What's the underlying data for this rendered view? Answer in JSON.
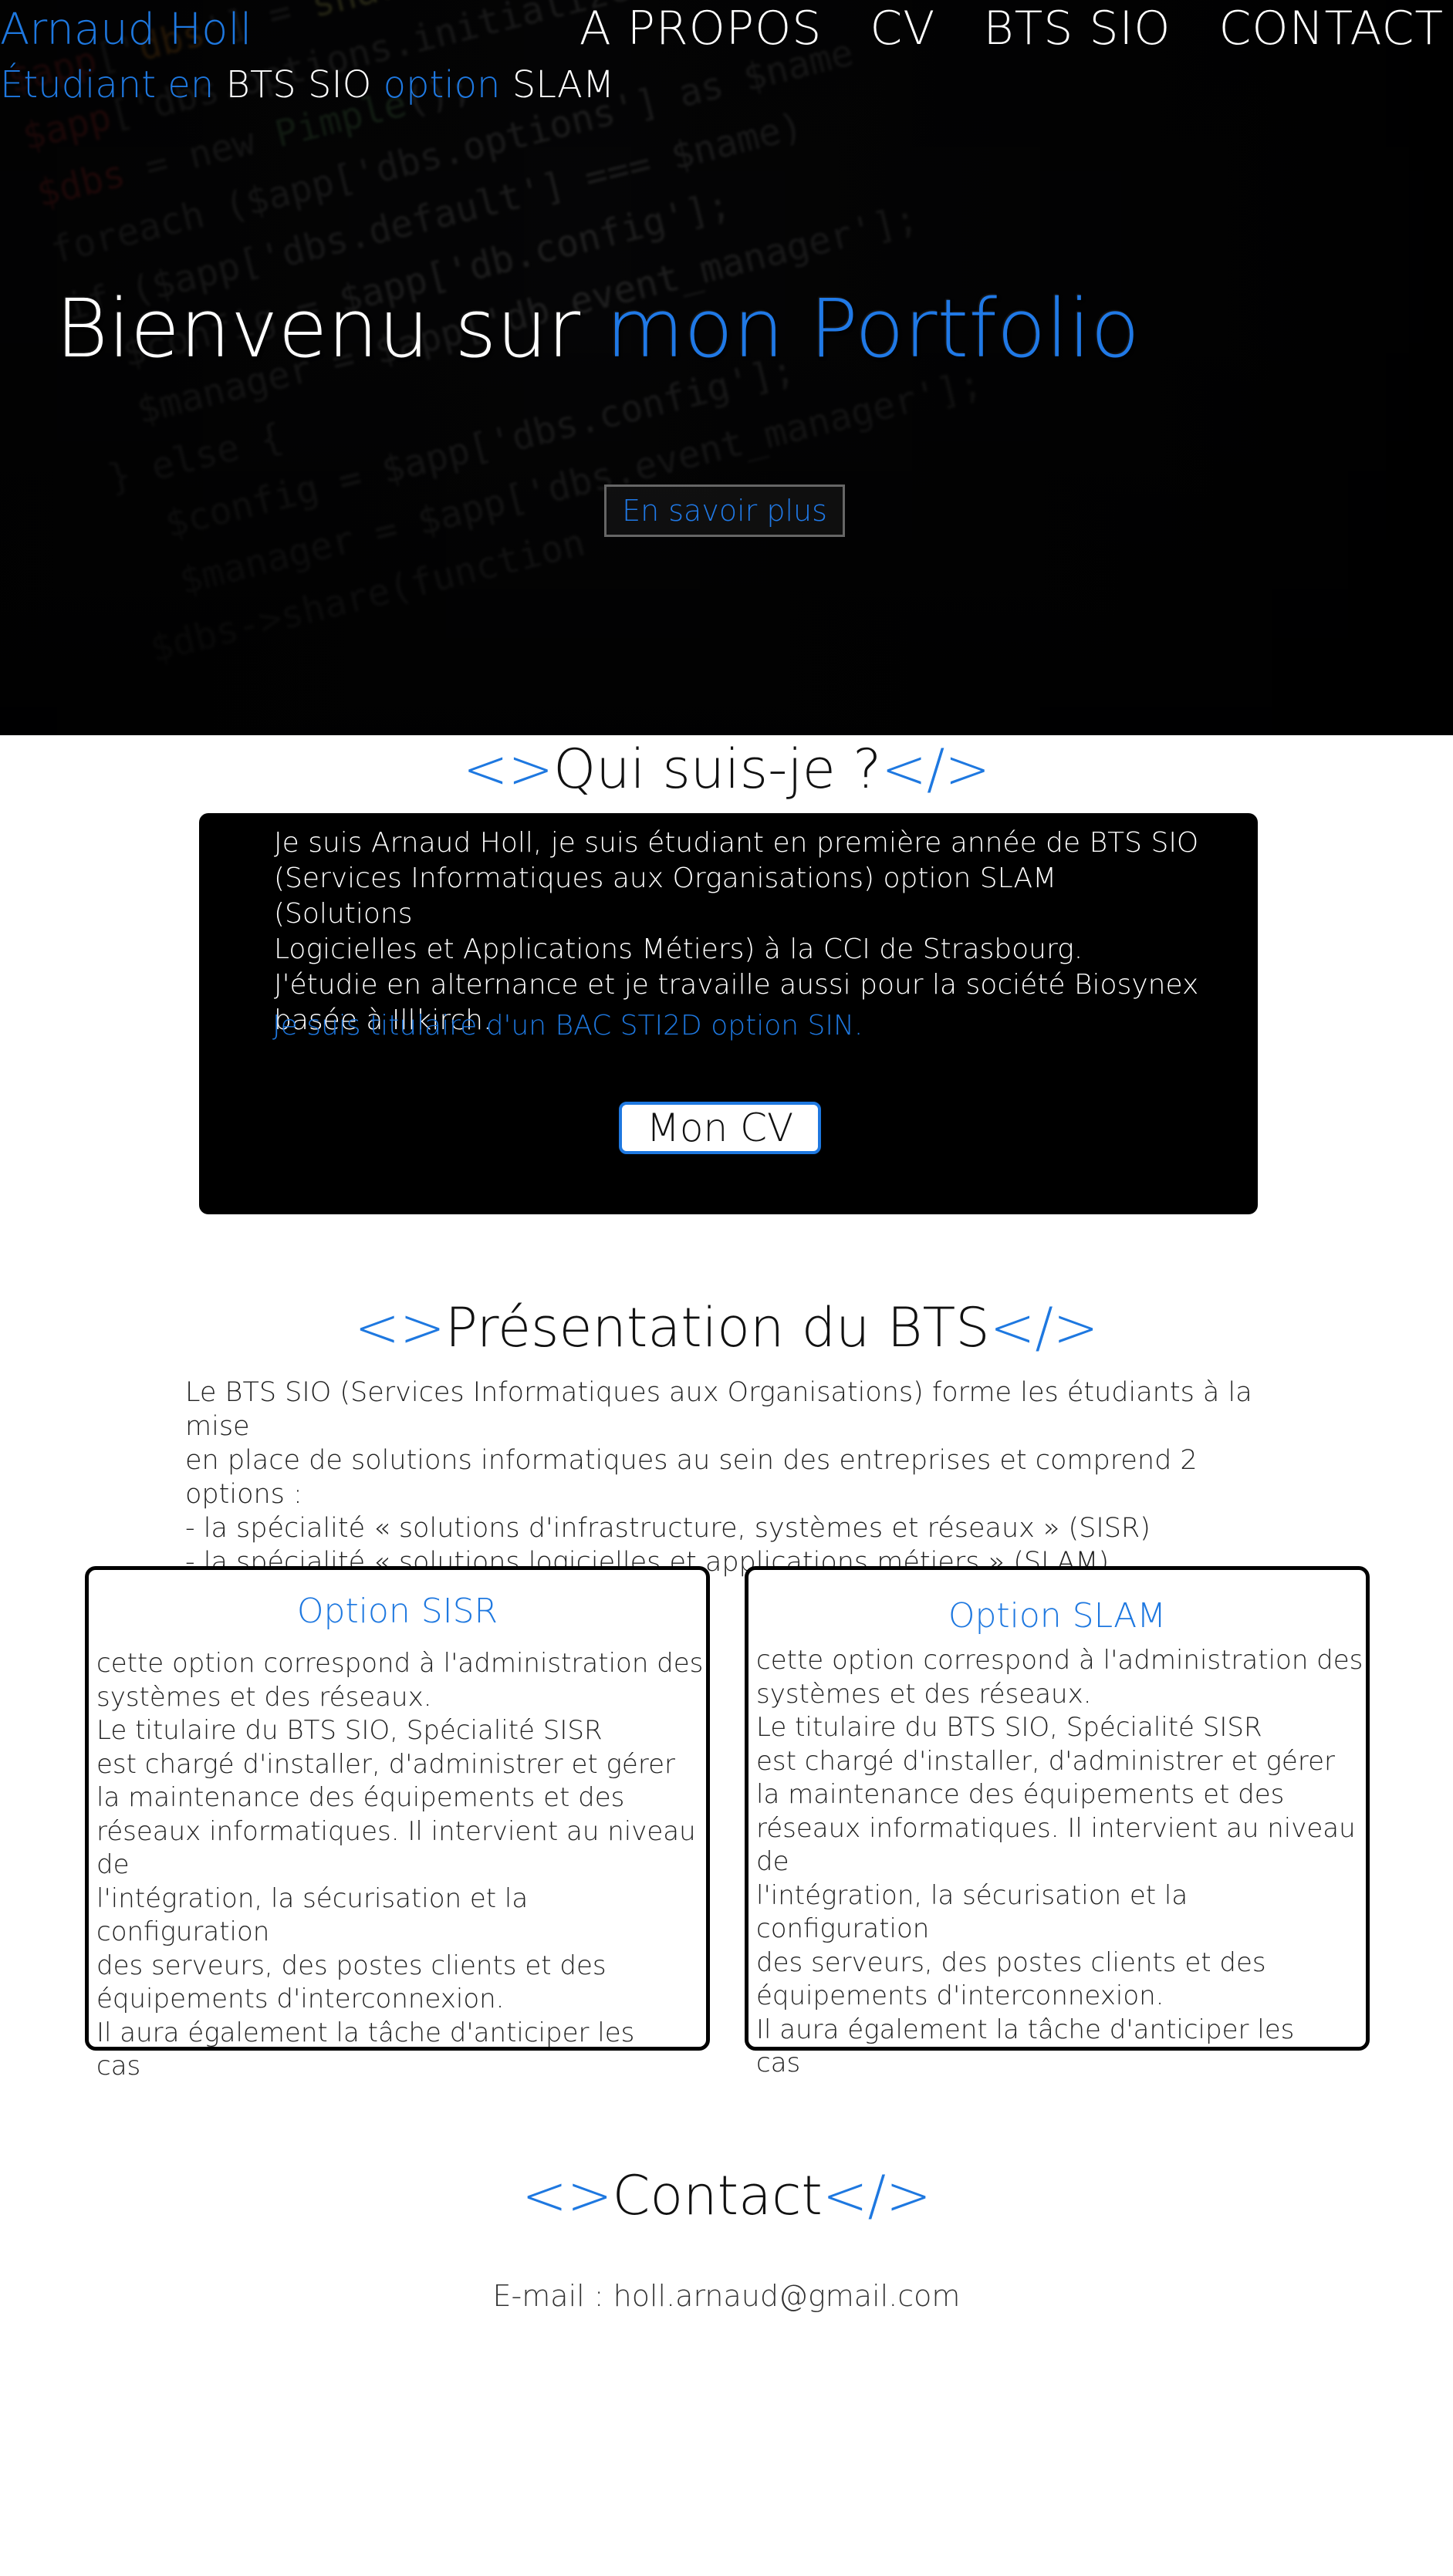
{
  "header": {
    "name": "Arnaud Holl",
    "subtitle_parts": [
      "Étudiant en",
      "BTS SIO",
      "option",
      "SLAM"
    ]
  },
  "nav": {
    "items": [
      "A PROPOS",
      "CV",
      "BTS SIO",
      "CONTACT"
    ]
  },
  "hero": {
    "title_white": "Bienvenu sur",
    "title_blue": "mon Portfolio",
    "button_label": "En savoir plus"
  },
  "about": {
    "title_open": "<>",
    "title": "Qui suis-je ?",
    "title_close": "</>",
    "paragraph_lines": [
      "Je suis Arnaud Holl, je suis étudiant en première année de BTS SIO",
      "(Services Informatiques aux Organisations) option SLAM (Solutions",
      "Logicielles et Applications Métiers) à la CCI de Strasbourg.",
      "J'étudie en alternance et je travaille aussi pour la société Biosynex",
      "basée à Illkirch."
    ],
    "diploma": "Je suis titulaire d'un BAC STI2D option SIN.",
    "cv_button": "Mon CV"
  },
  "bts": {
    "title_open": "<>",
    "title": "Présentation du BTS",
    "title_close": "</>",
    "intro_lines": [
      "Le BTS SIO (Services Informatiques aux Organisations) forme les étudiants à la mise",
      "en place de solutions informatiques au sein des entreprises et comprend 2 options :",
      "- la spécialité « solutions d'infrastructure, systèmes et réseaux » (SISR)",
      "- la spécialité « solutions logicielles et applications métiers » (SLAM)."
    ],
    "options": [
      {
        "title": "Option SISR",
        "body": "cette option correspond à l'administration des\nsystèmes et des réseaux.\nLe titulaire du BTS SIO, Spécialité SISR\n est chargé d'installer, d'administrer et gérer\n la maintenance des équipements et des\nréseaux informatiques. Il intervient au niveau de\nl'intégration, la sécurisation et la configuration\ndes serveurs, des postes clients et des\n équipements d'interconnexion.\nIl aura également la tâche d'anticiper les\n cas"
      },
      {
        "title": "Option SLAM",
        "body": "cette option correspond à l'administration des\nsystèmes et des réseaux.\nLe titulaire du BTS SIO, Spécialité SISR\n est chargé d'installer, d'administrer et gérer\n la maintenance des équipements et des\nréseaux informatiques. Il intervient au niveau de\nl'intégration, la sécurisation et la configuration\ndes serveurs, des postes clients et des\n équipements d'interconnexion.\nIl aura également la tâche d'anticiper les\n cas"
      }
    ]
  },
  "contact": {
    "title_open": "<>",
    "title": "Contact",
    "title_close": "</>",
    "email_label": "E-mail : holl.arnaud@gmail.com"
  },
  "colors": {
    "accent": "#1e78e0",
    "hero_bg": "#050506",
    "about_bg": "#000000"
  }
}
